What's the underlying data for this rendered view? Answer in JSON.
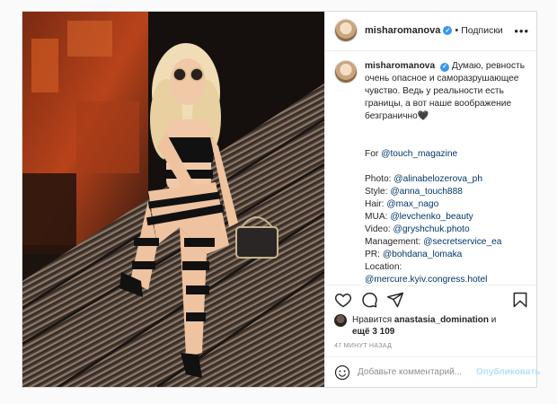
{
  "post": {
    "author": {
      "username": "misharomanova",
      "verified_glyph": "✓",
      "separator": "•",
      "follow_label": "Подписки"
    },
    "more_label": "•••",
    "caption": {
      "username": "misharomanova",
      "verified_glyph": "✓",
      "text_intro": "Думаю, ревность очень опасное и саморазрушающее чувство. Ведь у реальности есть границы, а вот наше воображение безгранично🖤",
      "for_line": "For @touch_magazine",
      "credits": [
        "Photo: @alinabelozerova_ph",
        "Style: @anna_touch888",
        "Hair: @max_nago",
        "MUA: @levchenko_beauty",
        "Video: @gryshchuk.photo",
        "Management: @secretservice_ea",
        "PR: @bohdana_lomaka",
        "Location:",
        "@mercure.kyiv.congress.hotel"
      ]
    },
    "actions": {
      "like_icon": "heart-icon",
      "comment_icon": "comment-icon",
      "share_icon": "share-icon",
      "save_icon": "bookmark-icon"
    },
    "likes": {
      "prefix": "Нравится",
      "user": "anastasia_domination",
      "suffix": "и",
      "others": "ещё 3 109"
    },
    "timestamp": "47 МИНУТ НАЗАД",
    "comment": {
      "placeholder": "Добавьте комментарий...",
      "publish_label": "Опубликовать"
    }
  }
}
